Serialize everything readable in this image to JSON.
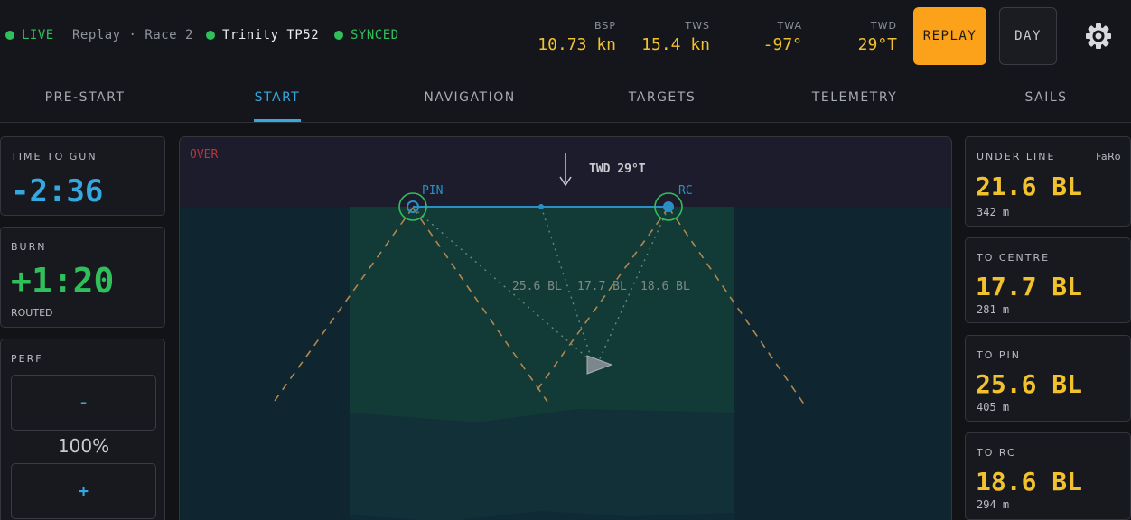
{
  "status": {
    "live_label": "LIVE",
    "source_label": "Replay · Race 2",
    "boat_name": "Trinity TP52",
    "sync_label": "SYNCED",
    "status_color": "#2fbf5b"
  },
  "metrics": [
    {
      "label": "BSP",
      "value": "10.73 kn"
    },
    {
      "label": "TWS",
      "value": "15.4 kn"
    },
    {
      "label": "TWA",
      "value": "-97°"
    },
    {
      "label": "TWD",
      "value": "29°T"
    }
  ],
  "buttons": {
    "replay_label": "REPLAY",
    "day_label": "DAY",
    "settings_icon": "gear-icon",
    "accent_color": "#fba11a"
  },
  "tabs": [
    {
      "label": "PRE-START",
      "active": false
    },
    {
      "label": "START",
      "active": true
    },
    {
      "label": "NAVIGATION",
      "active": false
    },
    {
      "label": "TARGETS",
      "active": false
    },
    {
      "label": "TELEMETRY",
      "active": false
    },
    {
      "label": "SAILS",
      "active": false
    }
  ],
  "left": {
    "time_to_gun": {
      "label": "TIME TO GUN",
      "value": "-2:36"
    },
    "burn": {
      "label": "BURN",
      "value": "+1:20",
      "sub": "ROUTED"
    },
    "perf": {
      "label": "PERF",
      "minus": "-",
      "value": "100%",
      "plus": "+"
    }
  },
  "map": {
    "over_label": "OVER",
    "wind_label": "TWD 29°T",
    "pin_label": "PIN",
    "rc_label": "RC",
    "dist_pin": "25.6 BL",
    "dist_centre": "17.7 BL",
    "dist_rc": "18.6 BL"
  },
  "right": [
    {
      "label": "UNDER LINE",
      "tag": "FaRo",
      "value": "21.6 BL",
      "sub": "342 m"
    },
    {
      "label": "TO CENTRE",
      "tag": "",
      "value": "17.7 BL",
      "sub": "281 m"
    },
    {
      "label": "TO PIN",
      "tag": "",
      "value": "25.6 BL",
      "sub": "405 m"
    },
    {
      "label": "TO RC",
      "tag": "",
      "value": "18.6 BL",
      "sub": "294 m"
    }
  ]
}
